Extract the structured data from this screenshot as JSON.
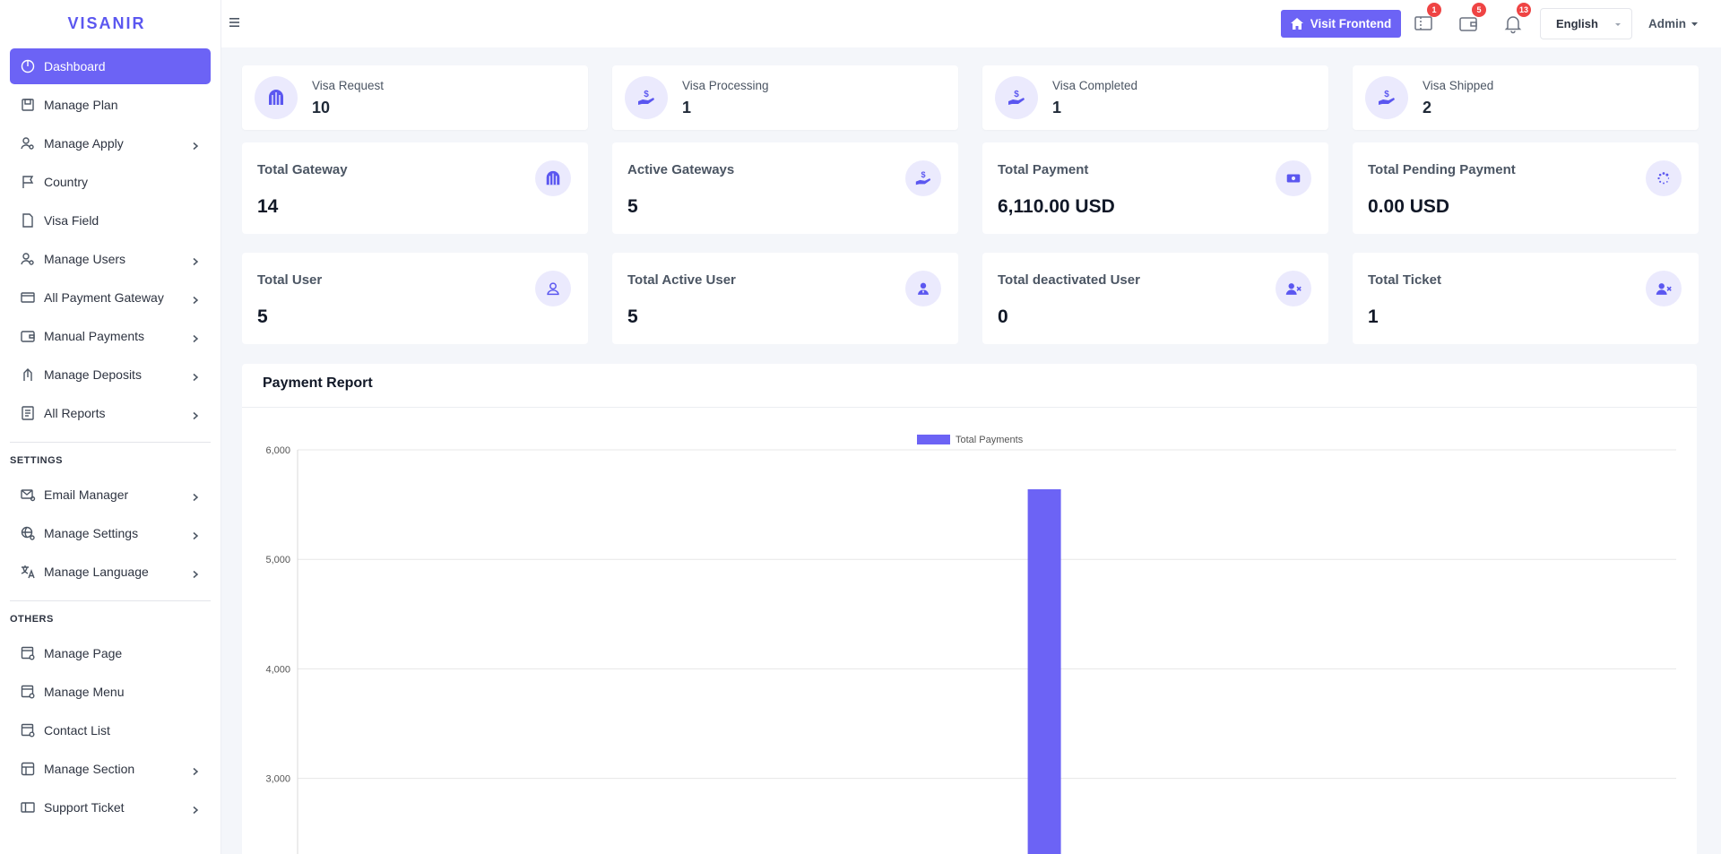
{
  "brand": "VISANIR",
  "sidebar": {
    "items": [
      {
        "label": "Dashboard",
        "icon": "dashboard-icon",
        "active": true,
        "chevron": false
      },
      {
        "label": "Manage Plan",
        "icon": "plan-icon",
        "chevron": false
      },
      {
        "label": "Manage Apply",
        "icon": "user-gear-icon",
        "chevron": true
      },
      {
        "label": "Country",
        "icon": "flag-icon",
        "chevron": false
      },
      {
        "label": "Visa Field",
        "icon": "file-icon",
        "chevron": false
      },
      {
        "label": "Manage Users",
        "icon": "user-gear-icon",
        "chevron": true
      },
      {
        "label": "All Payment Gateway",
        "icon": "card-icon",
        "chevron": true
      },
      {
        "label": "Manual Payments",
        "icon": "wallet-icon",
        "chevron": true
      },
      {
        "label": "Manage Deposits",
        "icon": "deposit-icon",
        "chevron": true
      },
      {
        "label": "All Reports",
        "icon": "report-icon",
        "chevron": true
      }
    ],
    "settings_title": "SETTINGS",
    "settings_items": [
      {
        "label": "Email Manager",
        "icon": "mail-gear-icon",
        "chevron": true
      },
      {
        "label": "Manage Settings",
        "icon": "settings-globe-icon",
        "chevron": true
      },
      {
        "label": "Manage Language",
        "icon": "translate-icon",
        "chevron": true
      }
    ],
    "others_title": "OTHERS",
    "others_items": [
      {
        "label": "Manage Page",
        "icon": "page-gear-icon",
        "chevron": false
      },
      {
        "label": "Manage Menu",
        "icon": "page-gear-icon",
        "chevron": false
      },
      {
        "label": "Contact List",
        "icon": "page-gear-icon",
        "chevron": false
      },
      {
        "label": "Manage Section",
        "icon": "layout-icon",
        "chevron": true
      },
      {
        "label": "Support Ticket",
        "icon": "ticket-icon",
        "chevron": true
      }
    ]
  },
  "topbar": {
    "visit_label": "Visit Frontend",
    "ticket_badge": "1",
    "wallet_badge": "5",
    "notif_badge": "13",
    "language": "English",
    "admin": "Admin"
  },
  "stats_small": [
    {
      "label": "Visa Request",
      "value": "10"
    },
    {
      "label": "Visa Processing",
      "value": "1"
    },
    {
      "label": "Visa Completed",
      "value": "1"
    },
    {
      "label": "Visa Shipped",
      "value": "2"
    }
  ],
  "stats_row2": [
    {
      "label": "Total Gateway",
      "value": "14"
    },
    {
      "label": "Active Gateways",
      "value": "5"
    },
    {
      "label": "Total Payment",
      "value": "6,110.00 USD"
    },
    {
      "label": "Total Pending Payment",
      "value": "0.00 USD"
    }
  ],
  "stats_row3": [
    {
      "label": "Total User",
      "value": "5"
    },
    {
      "label": "Total Active User",
      "value": "5"
    },
    {
      "label": "Total deactivated User",
      "value": "0"
    },
    {
      "label": "Total Ticket",
      "value": "1"
    }
  ],
  "report": {
    "title": "Payment Report"
  },
  "colors": {
    "accent": "#6c63f5",
    "accent_soft": "#ebeafd",
    "badge": "#ef4444"
  },
  "chart_data": {
    "type": "bar",
    "legend": [
      "Total Payments"
    ],
    "series": [
      {
        "name": "Total Payments",
        "values": [
          0,
          0,
          0,
          0,
          0,
          0,
          5640,
          0,
          0,
          0,
          0,
          0
        ]
      }
    ],
    "categories": [
      "",
      "",
      "",
      "",
      "",
      "",
      "",
      "",
      "",
      "",
      "",
      ""
    ],
    "y_ticks": [
      "6,000",
      "5,000",
      "4,000",
      "3,000"
    ],
    "ylim": [
      2300,
      6000
    ],
    "grid": true,
    "legend_position": "top-center"
  }
}
